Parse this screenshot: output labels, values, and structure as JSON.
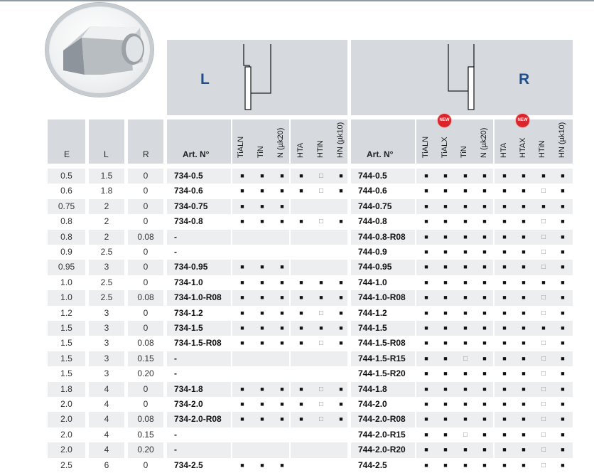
{
  "sides": {
    "left": "L",
    "right": "R"
  },
  "badge": "NEW",
  "headers": {
    "E": "E",
    "L": "L",
    "R": "R",
    "art_left": "Art. N°",
    "art_right": "Art. N°",
    "coatings_left": [
      "TiALN",
      "TiN",
      "N (µk20)",
      "HTA",
      "HTiN",
      "HN (µk10)"
    ],
    "coatings_right": [
      "TiALN",
      "TiALX",
      "TiN",
      "N (µk20)",
      "HTA",
      "HTAX",
      "HTiN",
      "HN (µk10)"
    ]
  },
  "marks": {
    "full": "■",
    "open": "□"
  },
  "rows": [
    {
      "E": "0.5",
      "L": "1.5",
      "R": "0",
      "artL": "734-0.5",
      "mL": [
        "f",
        "f",
        "f",
        "f",
        "o",
        "f"
      ],
      "artR": "744-0.5",
      "mR": [
        "f",
        "f",
        "f",
        "f",
        "f",
        "f",
        "f",
        "f"
      ]
    },
    {
      "E": "0.6",
      "L": "1.8",
      "R": "0",
      "artL": "734-0.6",
      "mL": [
        "f",
        "f",
        "f",
        "f",
        "o",
        "f"
      ],
      "artR": "744-0.6",
      "mR": [
        "f",
        "f",
        "f",
        "f",
        "f",
        "f",
        "o",
        "f"
      ]
    },
    {
      "E": "0.75",
      "L": "2",
      "R": "0",
      "artL": "734-0.75",
      "mL": [
        "f",
        "f",
        "f",
        "",
        "",
        ""
      ],
      "artR": "744-0.75",
      "mR": [
        "f",
        "f",
        "f",
        "f",
        "f",
        "f",
        "f",
        "f"
      ]
    },
    {
      "E": "0.8",
      "L": "2",
      "R": "0",
      "artL": "734-0.8",
      "mL": [
        "f",
        "f",
        "f",
        "f",
        "o",
        "f"
      ],
      "artR": "744-0.8",
      "mR": [
        "f",
        "f",
        "f",
        "f",
        "f",
        "f",
        "o",
        "f"
      ]
    },
    {
      "E": "0.8",
      "L": "2",
      "R": "0.08",
      "artL": "-",
      "mL": [
        "",
        "",
        "",
        "",
        "",
        ""
      ],
      "artR": "744-0.8-R08",
      "mR": [
        "f",
        "f",
        "f",
        "f",
        "f",
        "f",
        "o",
        "f"
      ]
    },
    {
      "E": "0.9",
      "L": "2.5",
      "R": "0",
      "artL": "-",
      "mL": [
        "",
        "",
        "",
        "",
        "",
        ""
      ],
      "artR": "744-0.9",
      "mR": [
        "f",
        "f",
        "f",
        "f",
        "f",
        "f",
        "o",
        "f"
      ]
    },
    {
      "E": "0.95",
      "L": "3",
      "R": "0",
      "artL": "734-0.95",
      "mL": [
        "f",
        "f",
        "f",
        "",
        "",
        ""
      ],
      "artR": "744-0.95",
      "mR": [
        "f",
        "f",
        "f",
        "f",
        "f",
        "f",
        "o",
        "f"
      ]
    },
    {
      "E": "1.0",
      "L": "2.5",
      "R": "0",
      "artL": "734-1.0",
      "mL": [
        "f",
        "f",
        "f",
        "f",
        "f",
        "f"
      ],
      "artR": "744-1.0",
      "mR": [
        "f",
        "f",
        "f",
        "f",
        "f",
        "f",
        "f",
        "f"
      ]
    },
    {
      "E": "1.0",
      "L": "2.5",
      "R": "0.08",
      "artL": "734-1.0-R08",
      "mL": [
        "f",
        "f",
        "f",
        "f",
        "f",
        "f"
      ],
      "artR": "744-1.0-R08",
      "mR": [
        "f",
        "f",
        "f",
        "f",
        "f",
        "f",
        "o",
        "f"
      ]
    },
    {
      "E": "1.2",
      "L": "3",
      "R": "0",
      "artL": "734-1.2",
      "mL": [
        "f",
        "f",
        "f",
        "f",
        "o",
        "f"
      ],
      "artR": "744-1.2",
      "mR": [
        "f",
        "f",
        "f",
        "f",
        "f",
        "f",
        "o",
        "f"
      ]
    },
    {
      "E": "1.5",
      "L": "3",
      "R": "0",
      "artL": "734-1.5",
      "mL": [
        "f",
        "f",
        "f",
        "f",
        "f",
        "f"
      ],
      "artR": "744-1.5",
      "mR": [
        "f",
        "f",
        "f",
        "f",
        "f",
        "f",
        "f",
        "f"
      ]
    },
    {
      "E": "1.5",
      "L": "3",
      "R": "0.08",
      "artL": "734-1.5-R08",
      "mL": [
        "f",
        "f",
        "f",
        "f",
        "o",
        "f"
      ],
      "artR": "744-1.5-R08",
      "mR": [
        "f",
        "f",
        "f",
        "f",
        "f",
        "f",
        "o",
        "f"
      ]
    },
    {
      "E": "1.5",
      "L": "3",
      "R": "0.15",
      "artL": "-",
      "mL": [
        "",
        "",
        "",
        "",
        "",
        ""
      ],
      "artR": "744-1.5-R15",
      "mR": [
        "f",
        "f",
        "o",
        "f",
        "f",
        "f",
        "o",
        "f"
      ]
    },
    {
      "E": "1.5",
      "L": "3",
      "R": "0.20",
      "artL": "-",
      "mL": [
        "",
        "",
        "",
        "",
        "",
        ""
      ],
      "artR": "744-1.5-R20",
      "mR": [
        "f",
        "f",
        "f",
        "f",
        "f",
        "f",
        "o",
        "f"
      ]
    },
    {
      "E": "1.8",
      "L": "4",
      "R": "0",
      "artL": "734-1.8",
      "mL": [
        "f",
        "f",
        "f",
        "f",
        "o",
        "f"
      ],
      "artR": "744-1.8",
      "mR": [
        "f",
        "f",
        "f",
        "f",
        "f",
        "f",
        "o",
        "f"
      ]
    },
    {
      "E": "2.0",
      "L": "4",
      "R": "0",
      "artL": "734-2.0",
      "mL": [
        "f",
        "f",
        "f",
        "f",
        "o",
        "f"
      ],
      "artR": "744-2.0",
      "mR": [
        "f",
        "f",
        "f",
        "f",
        "f",
        "f",
        "o",
        "f"
      ]
    },
    {
      "E": "2.0",
      "L": "4",
      "R": "0.08",
      "artL": "734-2.0-R08",
      "mL": [
        "f",
        "f",
        "f",
        "f",
        "o",
        "f"
      ],
      "artR": "744-2.0-R08",
      "mR": [
        "f",
        "f",
        "f",
        "f",
        "f",
        "f",
        "o",
        "f"
      ]
    },
    {
      "E": "2.0",
      "L": "4",
      "R": "0.15",
      "artL": "-",
      "mL": [
        "",
        "",
        "",
        "",
        "",
        ""
      ],
      "artR": "744-2.0-R15",
      "mR": [
        "f",
        "f",
        "o",
        "f",
        "f",
        "f",
        "o",
        "f"
      ]
    },
    {
      "E": "2.0",
      "L": "4",
      "R": "0.20",
      "artL": "-",
      "mL": [
        "",
        "",
        "",
        "",
        "",
        ""
      ],
      "artR": "744-2.0-R20",
      "mR": [
        "f",
        "f",
        "f",
        "f",
        "f",
        "f",
        "o",
        "f"
      ]
    },
    {
      "E": "2.5",
      "L": "6",
      "R": "0",
      "artL": "734-2.5",
      "mL": [
        "f",
        "f",
        "f",
        "",
        "",
        ""
      ],
      "artR": "744-2.5",
      "mR": [
        "f",
        "f",
        "f",
        "f",
        "f",
        "f",
        "o",
        "f"
      ]
    }
  ]
}
